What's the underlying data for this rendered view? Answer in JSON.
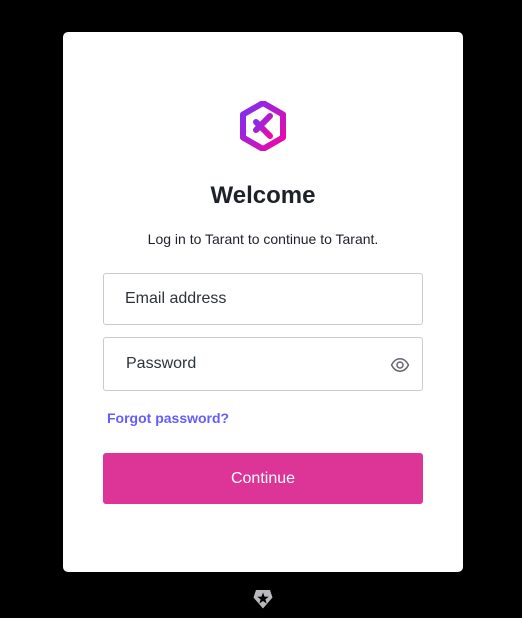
{
  "brand": {
    "logo_icon": "tarant-logo-icon",
    "logo_colors": [
      "#7b2ff7",
      "#f107a3"
    ]
  },
  "login": {
    "title": "Welcome",
    "subtitle": "Log in to Tarant to continue to Tarant.",
    "email_placeholder": "Email address",
    "password_placeholder": "Password",
    "show_password_icon": "eye-icon",
    "forgot_password_label": "Forgot password?",
    "continue_label": "Continue"
  },
  "footer": {
    "badge_icon": "auth0-shield-icon"
  },
  "colors": {
    "page_background": "#000000",
    "card_background": "#ffffff",
    "accent": "#dc3497",
    "link": "#635dff"
  }
}
